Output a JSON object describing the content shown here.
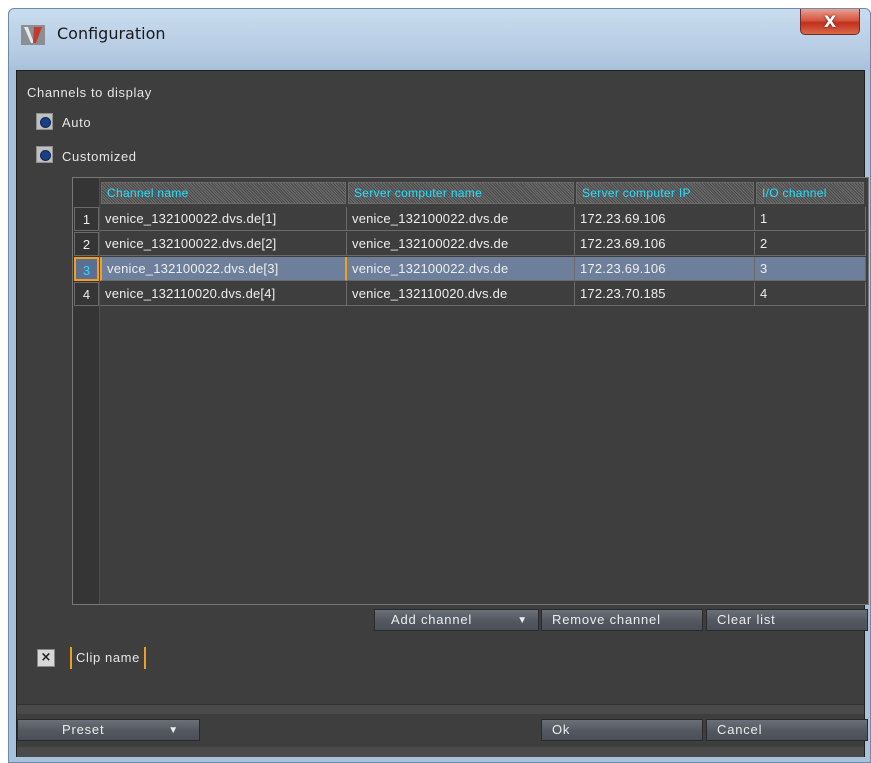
{
  "window": {
    "title": "Configuration",
    "close_glyph": "X"
  },
  "channels": {
    "label": "Channels to display",
    "auto_label": "Auto",
    "customized_label": "Customized"
  },
  "table": {
    "headers": [
      "Channel name",
      "Server computer name",
      "Server computer IP",
      "I/O channel"
    ],
    "rows": [
      {
        "num": "1",
        "channel_name": "venice_132100022.dvs.de[1]",
        "server_name": "venice_132100022.dvs.de",
        "server_ip": "172.23.69.106",
        "io_channel": "1"
      },
      {
        "num": "2",
        "channel_name": "venice_132100022.dvs.de[2]",
        "server_name": "venice_132100022.dvs.de",
        "server_ip": "172.23.69.106",
        "io_channel": "2"
      },
      {
        "num": "3",
        "channel_name": "venice_132100022.dvs.de[3]",
        "server_name": "venice_132100022.dvs.de",
        "server_ip": "172.23.69.106",
        "io_channel": "3"
      },
      {
        "num": "4",
        "channel_name": "venice_132110020.dvs.de[4]",
        "server_name": "venice_132110020.dvs.de",
        "server_ip": "172.23.70.185",
        "io_channel": "4"
      }
    ],
    "selected_row": 3
  },
  "actions": {
    "add_channel": "Add channel",
    "remove_channel": "Remove channel",
    "clear_list": "Clear list"
  },
  "clip": {
    "checked_glyph": "×",
    "label": "Clip name"
  },
  "footer": {
    "preset": "Preset",
    "ok": "Ok",
    "cancel": "Cancel",
    "dropdown_glyph": "▼"
  },
  "colors": {
    "header_text": "#22e0ff",
    "selection_bg": "#6e7f9c",
    "focus_border": "#f0a020",
    "panel_bg": "#3e3e3e"
  }
}
